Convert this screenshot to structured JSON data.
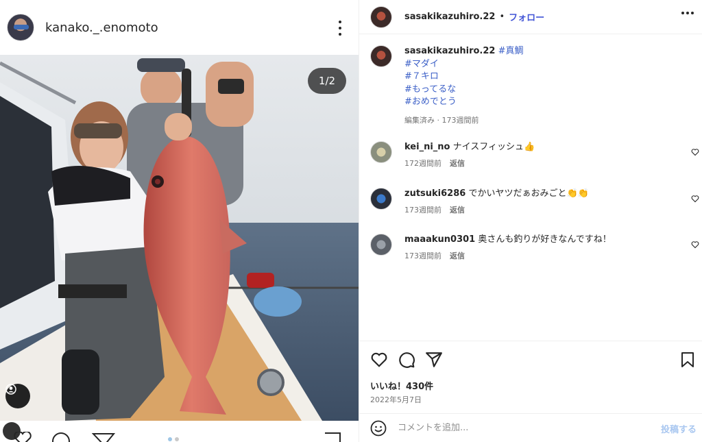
{
  "left_post": {
    "username": "kanako._.enomoto",
    "photo_counter": "1/2"
  },
  "post": {
    "username": "sasakikazuhiro.22",
    "separator": "•",
    "follow_label": "フォロー",
    "caption": {
      "first_tag": "#真鯛",
      "tags": [
        "#マダイ",
        "#７キロ",
        "#もってるな",
        "#おめでとう"
      ],
      "meta": "編集済み · 173週間前"
    },
    "comments": [
      {
        "username": "kei_ni_no",
        "text": "ナイスフィッシュ👍",
        "time": "172週間前",
        "reply": "返信"
      },
      {
        "username": "zutsuki6286",
        "text": "でかいヤツだぁおみごと👏👏",
        "time": "173週間前",
        "reply": "返信"
      },
      {
        "username": "maaakun0301",
        "text": "奥さんも釣りが好きなんですね！",
        "time": "173週間前",
        "reply": "返信"
      }
    ],
    "likes": "いいね！430件",
    "date": "2022年5月7日",
    "comment_placeholder": "コメントを追加...",
    "post_button": "投稿する"
  },
  "colors": {
    "link": "#3b5fc7",
    "follow": "#4154d6",
    "text": "#262626",
    "muted": "#737373",
    "post_disabled": "#a9c7f0"
  },
  "icons": [
    "heart-icon",
    "comment-icon",
    "share-icon",
    "bookmark-icon",
    "emoji-icon",
    "more-icon",
    "user-tag-icon"
  ]
}
